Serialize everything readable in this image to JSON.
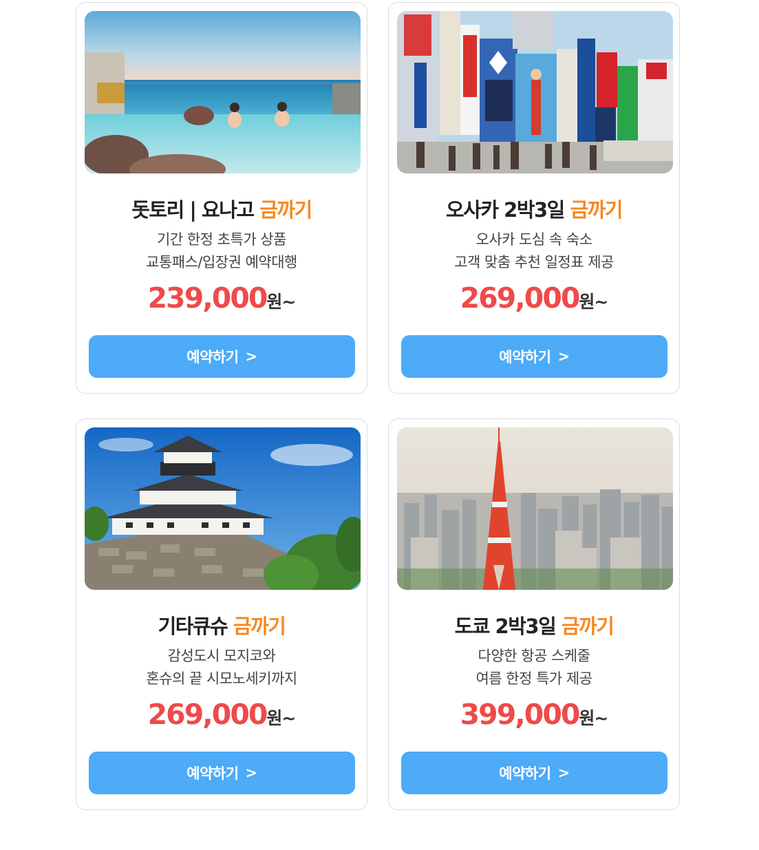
{
  "cards": [
    {
      "title_main": "돗토리 | 요나고 ",
      "title_highlight": "금까기",
      "desc_line1": "기간 한정 초특가 상품",
      "desc_line2": "교통패스/입장권 예약대행",
      "price": "239,000",
      "price_unit": "원~",
      "button_label": "예약하기",
      "button_chevron": ">",
      "image": "onsen-sea-view-photo"
    },
    {
      "title_main": "오사카 2박3일 ",
      "title_highlight": "금까기",
      "desc_line1": "오사카 도심 속 숙소",
      "desc_line2": "고객 맞춤 추천 일정표 제공",
      "price": "269,000",
      "price_unit": "원~",
      "button_label": "예약하기",
      "button_chevron": ">",
      "image": "dotonbori-street-photo"
    },
    {
      "title_main": "기타큐슈 ",
      "title_highlight": "금까기",
      "desc_line1": "감성도시 모지코와",
      "desc_line2": "혼슈의 끝 시모노세키까지",
      "price": "269,000",
      "price_unit": "원~",
      "button_label": "예약하기",
      "button_chevron": ">",
      "image": "kokura-castle-photo"
    },
    {
      "title_main": "도쿄 2박3일 ",
      "title_highlight": "금까기",
      "desc_line1": "다양한 항공 스케줄",
      "desc_line2": "여름 한정 특가 제공",
      "price": "399,000",
      "price_unit": "원~",
      "button_label": "예약하기",
      "button_chevron": ">",
      "image": "tokyo-tower-skyline-photo"
    }
  ],
  "colors": {
    "highlight": "#f6891f",
    "price": "#ef4a4a",
    "button": "#4dabf7"
  }
}
